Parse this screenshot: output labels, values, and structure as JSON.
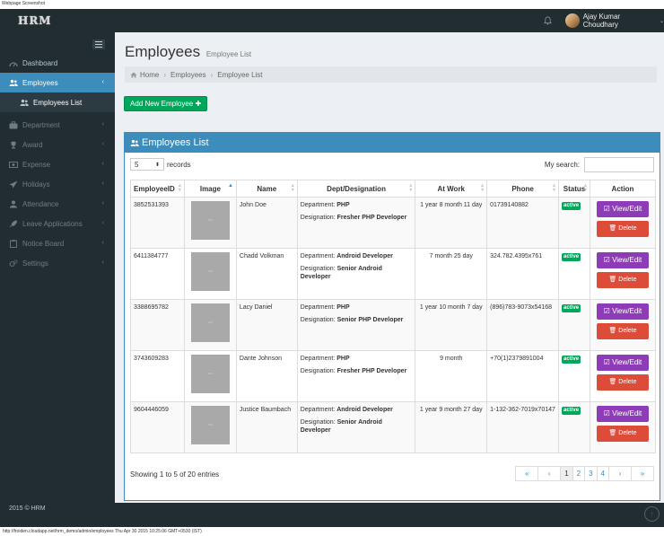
{
  "caption": "Webpage Screenshot",
  "footer_url": "http://froiden.cloudapp.net/hrm_demo/admin/employees Thu Apr 30 2015 10:25:06 GMT+0530 (IST)",
  "header": {
    "logo": "HRM",
    "user_name": "Ajay Kumar Choudhary",
    "bell_icon": "bell-icon",
    "caret": "⌄"
  },
  "sidebar": {
    "items": [
      {
        "label": "Dashboard",
        "icon": "dashboard-icon"
      },
      {
        "label": "Employees",
        "icon": "users-icon",
        "chevron": "‹"
      },
      {
        "label": "Employees List",
        "icon": "users-icon"
      },
      {
        "label": "Department",
        "icon": "briefcase-icon",
        "chevron": "‹"
      },
      {
        "label": "Award",
        "icon": "trophy-icon",
        "chevron": "‹"
      },
      {
        "label": "Expense",
        "icon": "money-icon",
        "chevron": "‹"
      },
      {
        "label": "Holidays",
        "icon": "paper-plane-icon",
        "chevron": "‹"
      },
      {
        "label": "Attendance",
        "icon": "user-icon",
        "chevron": "‹"
      },
      {
        "label": "Leave Applications",
        "icon": "rocket-icon",
        "chevron": "‹"
      },
      {
        "label": "Notice Board",
        "icon": "clipboard-icon",
        "chevron": "‹"
      },
      {
        "label": "Settings",
        "icon": "cogs-icon",
        "chevron": "‹"
      }
    ],
    "footer": "2015 © HRM"
  },
  "page": {
    "title": "Employees",
    "subtitle": "Employee List",
    "breadcrumb": [
      "Home",
      "Employees",
      "Employee List"
    ],
    "breadcrumb_sep": "›",
    "add_button": "Add New Employee ✚"
  },
  "box": {
    "title": "Employees List",
    "records_value": "5",
    "records_label": "records",
    "search_label": "My search:",
    "search_value": "",
    "columns": [
      "EmployeeID",
      "Image",
      "Name",
      "Dept/Designation",
      "At Work",
      "Phone",
      "Status",
      "Action"
    ],
    "sort_glyph": "▲",
    "dept_prefix": "Department:",
    "desig_prefix": "Designation:",
    "rows": [
      {
        "id": "3852531393",
        "img": "IMG",
        "name": "John Doe",
        "dept": "PHP",
        "desig": "Fresher PHP Developer",
        "at_work": "1 year 8 month 11 day",
        "phone": "01739140882",
        "status": "active"
      },
      {
        "id": "6411384777",
        "img": "IMG",
        "name": "Chadd Volkman",
        "dept": "Android Developer",
        "desig": "Senior Android Developer",
        "at_work": "7 month 25 day",
        "phone": "324.782.4395x761",
        "status": "active"
      },
      {
        "id": "3388695782",
        "img": "IMG",
        "name": "Lacy Daniel",
        "dept": "PHP",
        "desig": "Senior PHP Developer",
        "at_work": "1 year 10 month 7 day",
        "phone": "(896)783-9073x54168",
        "status": "active"
      },
      {
        "id": "3743609283",
        "img": "IMG",
        "name": "Dante Johnson",
        "dept": "PHP",
        "desig": "Fresher PHP Developer",
        "at_work": "9 month",
        "phone": "+70(1)2379891004",
        "status": "active"
      },
      {
        "id": "9604446059",
        "img": "IMG",
        "name": "Justice Baumbach",
        "dept": "Android Developer",
        "desig": "Senior Android Developer",
        "at_work": "1 year 9 month 27 day",
        "phone": "1-132-362-7019x70147",
        "status": "active"
      }
    ],
    "view_edit_label": "☑ View/Edit",
    "delete_label": "🗑 Delete",
    "showing": "Showing 1 to 5 of 20 entries",
    "pagination": [
      "«",
      "‹",
      "1",
      "2",
      "3",
      "4",
      "›",
      "»"
    ],
    "active_page": "1"
  },
  "colors": {
    "sidebar": "#222d32",
    "primary": "#3c8dbc",
    "success": "#00a65a",
    "edit": "#8e3bb7",
    "danger": "#dd4b39"
  }
}
